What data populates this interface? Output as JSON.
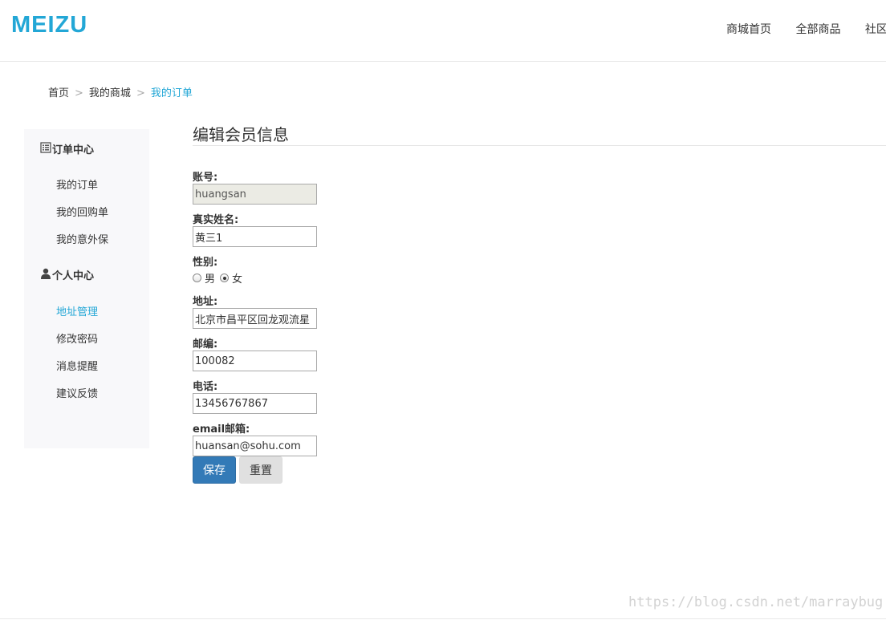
{
  "brand": {
    "logo_text": "MEIZU",
    "color": "#23a7d6"
  },
  "topnav": [
    "商城首页",
    "全部商品",
    "社区"
  ],
  "breadcrumb": {
    "home": "首页",
    "sep": ">",
    "mall": "我的商城",
    "current": "我的订单"
  },
  "sidebar": {
    "order_center": {
      "icon": "list-icon",
      "title": "订单中心",
      "items": [
        "我的订单",
        "我的回购单",
        "我的意外保"
      ]
    },
    "personal_center": {
      "icon": "user-icon",
      "title": "个人中心",
      "items": [
        "地址管理",
        "修改密码",
        "消息提醒",
        "建议反馈"
      ],
      "active_index": 0
    }
  },
  "form": {
    "title": "编辑会员信息",
    "account": {
      "label": "账号:",
      "value": "huangsan"
    },
    "realname": {
      "label": "真实姓名:",
      "value": "黄三1"
    },
    "gender": {
      "label": "性别:",
      "options": [
        "男",
        "女"
      ],
      "selected": "女"
    },
    "address": {
      "label": "地址:",
      "value": "北京市昌平区回龙观流星"
    },
    "zipcode": {
      "label": "邮编:",
      "value": "100082"
    },
    "phone": {
      "label": "电话:",
      "value": "13456767867"
    },
    "email": {
      "label": "email邮箱:",
      "value": "huansan@sohu.com"
    },
    "save_label": "保存",
    "reset_label": "重置"
  },
  "watermark": "https://blog.csdn.net/marraybug",
  "colors": {
    "accent": "#23a7d6",
    "primary_button": "#337ab7"
  }
}
